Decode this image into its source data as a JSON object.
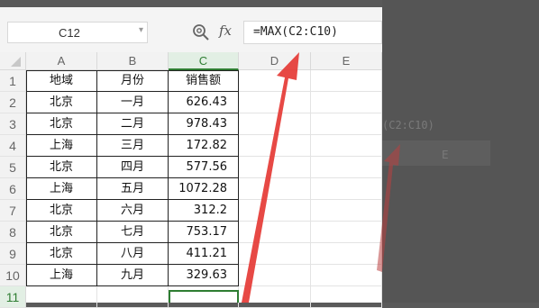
{
  "toolbar": {
    "name_box": "C12",
    "zoom_icon": "zoom-icon",
    "fx_label": "fx",
    "formula": "=MAX(C2:C10)"
  },
  "background_ghost": {
    "formula_fragment": "(C2:C10)",
    "column_e": "E"
  },
  "columns": [
    "A",
    "B",
    "C",
    "D",
    "E"
  ],
  "rows": [
    "1",
    "2",
    "3",
    "4",
    "5",
    "6",
    "7",
    "8",
    "9",
    "10",
    "11"
  ],
  "table": {
    "headers": [
      "地域",
      "月份",
      "销售额"
    ],
    "data": [
      [
        "北京",
        "一月",
        "626.43"
      ],
      [
        "北京",
        "二月",
        "978.43"
      ],
      [
        "上海",
        "三月",
        "172.82"
      ],
      [
        "北京",
        "四月",
        "577.56"
      ],
      [
        "上海",
        "五月",
        "1072.28"
      ],
      [
        "北京",
        "六月",
        "312.2"
      ],
      [
        "北京",
        "七月",
        "753.17"
      ],
      [
        "北京",
        "八月",
        "411.21"
      ],
      [
        "上海",
        "九月",
        "329.63"
      ]
    ]
  },
  "selection": {
    "cell": "C12",
    "active_column": "C",
    "active_row": "12"
  },
  "colors": {
    "accent_green": "#2e7d32",
    "arrow_red": "#e53935"
  }
}
